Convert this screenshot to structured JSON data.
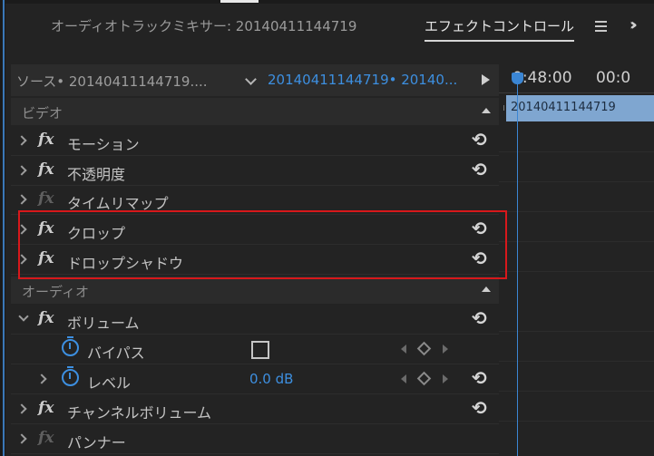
{
  "tabs": {
    "mixer": "オーディオトラックミキサー: 20140411144719",
    "effects": "エフェクトコントロール"
  },
  "source_bar": {
    "source_label": "ソース• 20140411144719....",
    "clip_label": "20140411144719• 20140..."
  },
  "timeline": {
    "time_a": "0:48:00",
    "time_b": "00:0",
    "clip_name": "20140411144719"
  },
  "sections": {
    "video": "ビデオ",
    "audio": "オーディオ"
  },
  "video_effects": [
    {
      "label": "モーション"
    },
    {
      "label": "不透明度"
    },
    {
      "label": "タイムリマップ"
    },
    {
      "label": "クロップ"
    },
    {
      "label": "ドロップシャドウ"
    }
  ],
  "audio_effects": {
    "volume": "ボリューム",
    "bypass": "バイパス",
    "level": "レベル",
    "level_value": "0.0 dB",
    "channel_volume": "チャンネルボリューム",
    "panner": "パンナー"
  },
  "icons": {
    "reset": "reset-icon",
    "stopwatch": "stopwatch-icon"
  },
  "colors": {
    "accent": "#3d8fe0",
    "highlight_box": "#d7181b",
    "clip_block": "#7fa6d0",
    "panel_bg": "#232323"
  }
}
